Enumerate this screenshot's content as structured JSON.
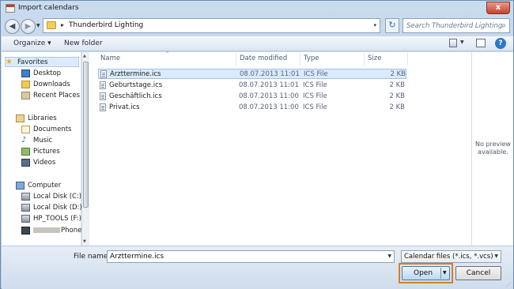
{
  "window": {
    "title": "Import calendars",
    "close_glyph": "x"
  },
  "address_bar": {
    "separator": "▸",
    "path": "Thunderbird Lighting",
    "dropdown_glyph": "▾",
    "refresh_glyph": "↻"
  },
  "search": {
    "placeholder": "Search Thunderbird Lighting",
    "icon_glyph": "⌕"
  },
  "toolbar": {
    "organize_label": "Organize ▾",
    "new_folder_label": "New folder",
    "help_glyph": "?"
  },
  "sidebar": {
    "favorites": {
      "label": "Favorites",
      "icon": "star-icon"
    },
    "favorite_items": [
      {
        "label": "Desktop",
        "icon": "desktop-icon"
      },
      {
        "label": "Downloads",
        "icon": "downloads-folder-icon"
      },
      {
        "label": "Recent Places",
        "icon": "recent-places-icon"
      }
    ],
    "libraries": {
      "label": "Libraries",
      "icon": "libraries-icon"
    },
    "library_items": [
      {
        "label": "Documents",
        "icon": "documents-icon"
      },
      {
        "label": "Music",
        "icon": "music-icon"
      },
      {
        "label": "Pictures",
        "icon": "pictures-icon"
      },
      {
        "label": "Videos",
        "icon": "videos-icon"
      }
    ],
    "computer": {
      "label": "Computer",
      "icon": "computer-icon"
    },
    "computer_items": [
      {
        "label": "Local Disk (C:)",
        "icon": "disk-icon"
      },
      {
        "label": "Local Disk (D:)",
        "icon": "disk-icon"
      },
      {
        "label": "HP_TOOLS (F:)",
        "icon": "disk-icon"
      },
      {
        "label": "Phone",
        "icon": "phone-icon"
      }
    ]
  },
  "file_list": {
    "columns": {
      "name": "Name",
      "date": "Date modified",
      "type": "Type",
      "size": "Size"
    },
    "sort_glyph": "^",
    "rows": [
      {
        "name": "Arzttermine.ics",
        "date": "08.07.2013 11:01",
        "type": "ICS File",
        "size": "2 KB",
        "selected": true
      },
      {
        "name": "Geburtstage.ics",
        "date": "08.07.2013 11:01",
        "type": "ICS File",
        "size": "2 KB",
        "selected": false
      },
      {
        "name": "Geschäftlich.ics",
        "date": "08.07.2013 11:00",
        "type": "ICS File",
        "size": "2 KB",
        "selected": false
      },
      {
        "name": "Privat.ics",
        "date": "08.07.2013 11:00",
        "type": "ICS File",
        "size": "2 KB",
        "selected": false
      }
    ]
  },
  "preview": {
    "line1": "No preview",
    "line2": "available."
  },
  "footer": {
    "file_name_label": "File name:",
    "file_name_value": "Arzttermine.ics",
    "filter_value": "Calendar files (*.ics, *.vcs)",
    "open_label": "Open",
    "cancel_label": "Cancel",
    "highlight_color": "#e07a1f"
  }
}
